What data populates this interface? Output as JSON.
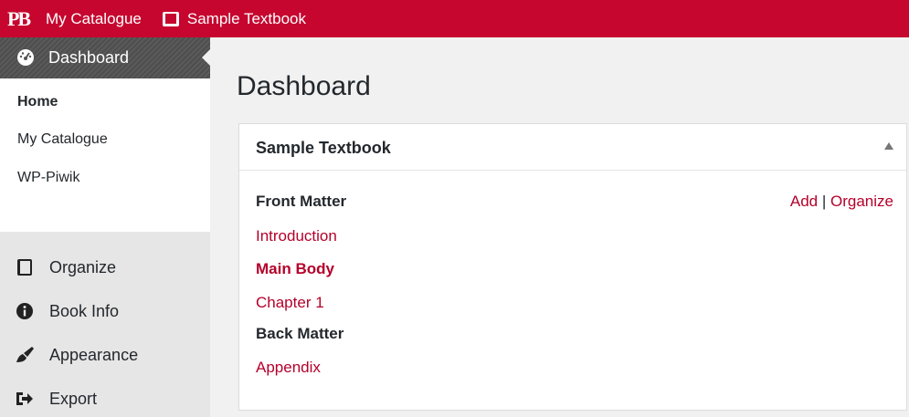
{
  "adminbar": {
    "logo_text": "PB",
    "catalogue_label": "My Catalogue",
    "book_label": "Sample Textbook",
    "accent_color": "#c6062f"
  },
  "sidebar": {
    "active_item": {
      "label": "Dashboard",
      "icon": "dashboard-gauge-icon"
    },
    "submenu": [
      {
        "label": "Home",
        "current": true
      },
      {
        "label": "My Catalogue",
        "current": false
      },
      {
        "label": "WP-Piwik",
        "current": false
      }
    ],
    "items": [
      {
        "label": "Organize",
        "icon": "book-icon"
      },
      {
        "label": "Book Info",
        "icon": "info-icon"
      },
      {
        "label": "Appearance",
        "icon": "paintbrush-icon"
      },
      {
        "label": "Export",
        "icon": "export-icon"
      }
    ]
  },
  "main": {
    "page_title": "Dashboard",
    "panel": {
      "title": "Sample Textbook",
      "actions": {
        "add": "Add",
        "separator": "|",
        "organize": "Organize"
      },
      "front_matter": "Front Matter",
      "introduction": "Introduction",
      "main_body": "Main Body",
      "chapter_1": "Chapter 1",
      "back_matter": "Back Matter",
      "appendix": "Appendix"
    }
  }
}
